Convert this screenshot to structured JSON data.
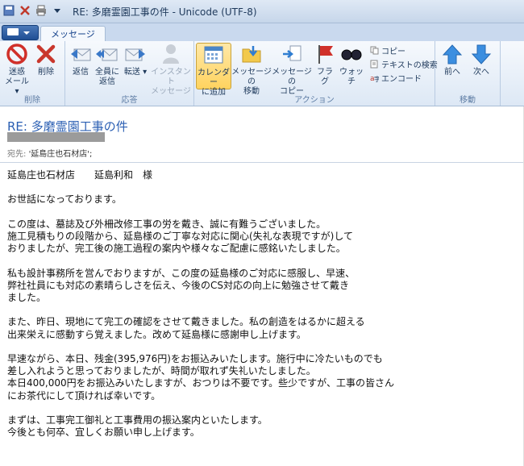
{
  "window": {
    "title": "RE: 多磨霊園工事の件 - Unicode (UTF-8)"
  },
  "ribbon": {
    "tab": "メッセージ",
    "groups": {
      "delete": "削除",
      "respond": "応答",
      "actions": "アクション",
      "move": "移動"
    },
    "buttons": {
      "junk": [
        "迷惑",
        "メール ▾"
      ],
      "delete": "削除",
      "reply": "返信",
      "reply_all": [
        "全員に",
        "返信"
      ],
      "forward": [
        "転送",
        "▾"
      ],
      "instant": [
        "インスタント",
        "メッセージ"
      ],
      "calendar": [
        "カレンダー",
        "に追加"
      ],
      "move_msg": [
        "メッセージの",
        "移動"
      ],
      "copy_msg": [
        "メッセージの",
        "コピー"
      ],
      "flag": "フラグ",
      "watch": "ウォッチ",
      "copy": "コピー",
      "find_text": "テキストの検索",
      "encode": "エンコード",
      "prev": "前へ",
      "next": "次へ"
    }
  },
  "message": {
    "subject": "RE: 多磨霊園工事の件",
    "to_label": "宛先:",
    "to_value": "'延島庄也石材店';",
    "body": [
      "延島庄也石材店　　延島利和　様",
      "",
      "お世話になっております。",
      "",
      "この度は、墓誌及び外柵改修工事の労を戴き、誠に有難うございました。",
      "施工見積もりの段階から、延島様のご丁寧な対応に関心(失礼な表現ですが)して",
      "おりましたが、完工後の施工過程の案内や様々なご配慮に感銘いたしました。",
      "",
      "私も設計事務所を営んでおりますが、この度の延島様のご対応に感服し、早速、",
      "弊社社員にも対応の素晴らしさを伝え、今後のCS対応の向上に勉強させて戴き",
      "ました。",
      "",
      "また、昨日、現地にて完工の確認をさせて戴きました。私の創造をはるかに超える",
      "出来栄えに感動すら覚えました。改めて延島様に感謝申し上げます。",
      "",
      "早速ながら、本日、残金(395,976円)をお振込みいたします。施行中に冷たいものでも",
      "差し入れようと思っておりましたが、時間が取れず失礼いたしました。",
      "本日400,000円をお振込みいたしますが、おつりは不要です。些少ですが、工事の皆さん",
      "にお茶代にして頂ければ幸いです。",
      "",
      "まずは、工事完工御礼と工事費用の振込案内といたします。",
      "今後とも何卒、宜しくお願い申し上げます。"
    ]
  },
  "icons": [
    "save-icon",
    "delete-icon",
    "print-icon",
    "dropdown-icon",
    "junk-icon",
    "reply-icon",
    "reply-all-icon",
    "forward-icon",
    "instant-message-icon",
    "calendar-icon",
    "move-icon",
    "copy-icon",
    "flag-icon",
    "watch-icon",
    "find-icon",
    "encode-icon",
    "up-arrow-icon",
    "down-arrow-icon"
  ],
  "colors": {
    "subject": "#2b5fb3",
    "accent": "#15428b",
    "active_button": "#ffd35f"
  }
}
